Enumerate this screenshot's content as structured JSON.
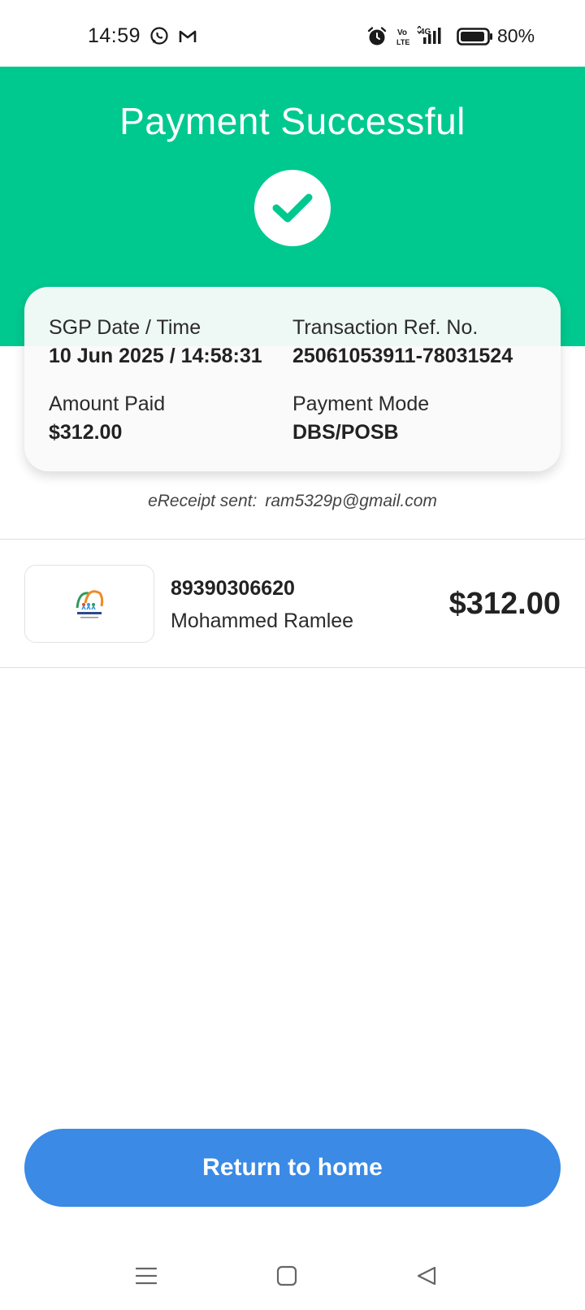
{
  "status_bar": {
    "time": "14:59",
    "battery_percent": "80%",
    "battery_level": 0.8,
    "network": "4G",
    "volte": "Vo LTE",
    "icons": [
      "whatsapp-icon",
      "gmail-icon",
      "alarm-icon",
      "volte-icon",
      "signal-icon",
      "battery-icon"
    ]
  },
  "header": {
    "title": "Payment Successful",
    "icon": "checkmark-icon",
    "color": "#00c98f"
  },
  "details": {
    "date_label": "SGP Date / Time",
    "date_value": "10 Jun 2025 / 14:58:31",
    "ref_label": "Transaction Ref. No.",
    "ref_value": "25061053911-78031524",
    "amount_label": "Amount Paid",
    "amount_value": "$312.00",
    "mode_label": "Payment Mode",
    "mode_value": "DBS/POSB"
  },
  "ereceipt": {
    "label": "eReceipt sent:",
    "email": "ram5329p@gmail.com"
  },
  "account": {
    "number": "89390306620",
    "name": "Mohammed Ramlee",
    "amount": "$312.00",
    "logo": "merchant-logo"
  },
  "actions": {
    "return_label": "Return to home",
    "button_color": "#3a8ae6"
  },
  "nav": {
    "icons": [
      "menu-icon",
      "home-square-icon",
      "back-triangle-icon"
    ]
  }
}
